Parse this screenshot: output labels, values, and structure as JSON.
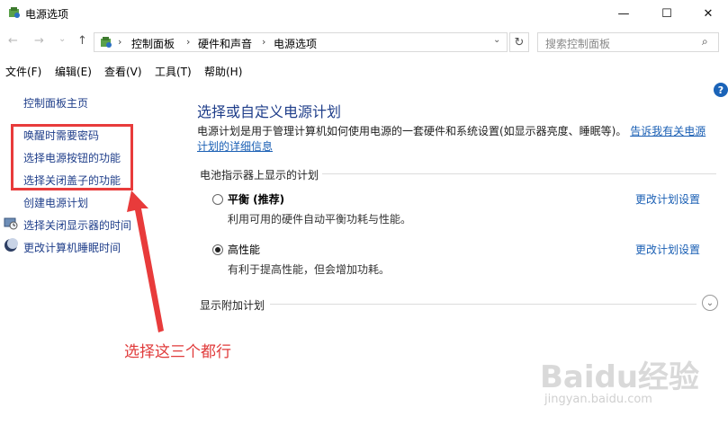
{
  "window": {
    "title": "电源选项",
    "minimize": "—",
    "maximize": "☐",
    "close": "✕"
  },
  "nav": {
    "back": "←",
    "forward": "→",
    "recent": "⌄",
    "up": "↑"
  },
  "address": {
    "crumbs": [
      "控制面板",
      "硬件和声音",
      "电源选项"
    ],
    "separator": "›",
    "dropdown": "⌄",
    "refresh": "↻"
  },
  "search": {
    "placeholder": "搜索控制面板",
    "icon": "⌕"
  },
  "menu": [
    "文件(F)",
    "编辑(E)",
    "查看(V)",
    "工具(T)",
    "帮助(H)"
  ],
  "help": "?",
  "sidebar": {
    "home": "控制面板主页",
    "items": [
      {
        "label": "唤醒时需要密码",
        "icon": ""
      },
      {
        "label": "选择电源按钮的功能",
        "icon": ""
      },
      {
        "label": "选择关闭盖子的功能",
        "icon": ""
      },
      {
        "label": "创建电源计划",
        "icon": ""
      },
      {
        "label": "选择关闭显示器的时间",
        "icon": "monitor-icon"
      },
      {
        "label": "更改计算机睡眠时间",
        "icon": "moon-icon"
      }
    ]
  },
  "main": {
    "title": "选择或自定义电源计划",
    "desc": "电源计划是用于管理计算机如何使用电源的一套硬件和系统设置(如显示器亮度、睡眠等)。",
    "desc_link": "告诉我有关电源计划的详细信息",
    "section1": "电池指示器上显示的计划",
    "plans": [
      {
        "name": "平衡 (推荐)",
        "desc": "利用可用的硬件自动平衡功耗与性能。",
        "link": "更改计划设置",
        "selected": false
      },
      {
        "name": "高性能",
        "desc": "有利于提高性能，但会增加功耗。",
        "link": "更改计划设置",
        "selected": true
      }
    ],
    "section2": "显示附加计划",
    "expand": "⌄"
  },
  "annotation": "选择这三个都行",
  "annotation_color": "#e03a3a",
  "watermark": {
    "logo": "Baidu经验",
    "url": "jingyan.baidu.com"
  }
}
